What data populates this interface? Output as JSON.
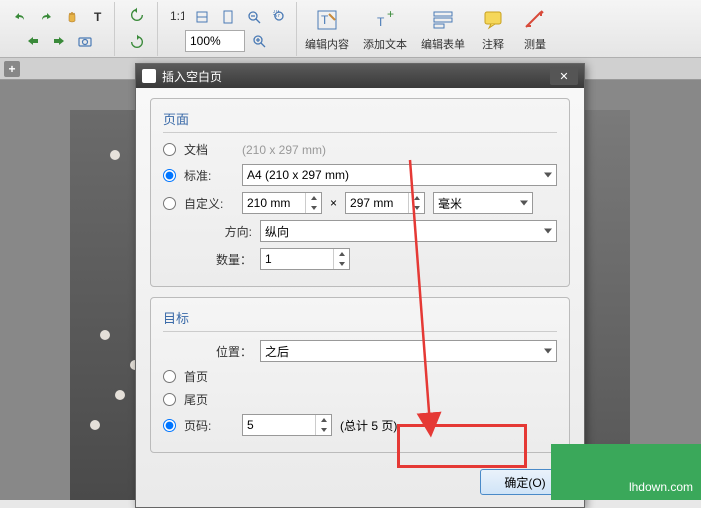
{
  "toolbar": {
    "zoom_value": "100%",
    "big_buttons": [
      {
        "label": "编辑内容"
      },
      {
        "label": "添加文本"
      },
      {
        "label": "编辑表单"
      },
      {
        "label": "注释"
      },
      {
        "label": "测量"
      }
    ]
  },
  "dialog": {
    "title": "插入空白页",
    "page_section": {
      "title": "页面",
      "doc_radio": "文档",
      "doc_hint": "(210 x 297 mm)",
      "std_radio": "标准:",
      "std_value": "A4 (210 x 297 mm)",
      "custom_radio": "自定义:",
      "width": "210 mm",
      "times": "×",
      "height": "297 mm",
      "unit": "毫米",
      "orient_label": "方向:",
      "orient_value": "纵向",
      "count_label": "数量：",
      "count_value": "1"
    },
    "target_section": {
      "title": "目标",
      "pos_label": "位置：",
      "pos_value": "之后",
      "first_radio": "首页",
      "last_radio": "尾页",
      "pageno_radio": "页码:",
      "pageno_value": "5",
      "total_hint": "(总计 5 页)"
    },
    "ok_button": "确定(O)"
  },
  "watermark": "lhdown.com"
}
